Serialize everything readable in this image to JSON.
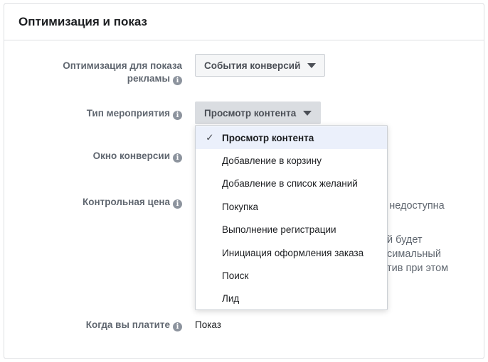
{
  "panel": {
    "title": "Оптимизация и показ"
  },
  "fields": {
    "optimization": {
      "label_line1": "Оптимизация для показа",
      "label_line2": "рекламы",
      "value": "События конверсий"
    },
    "event_type": {
      "label": "Тип мероприятия",
      "value": "Просмотр контента"
    },
    "conversion_window": {
      "label": "Окно конверсии"
    },
    "bid_cap": {
      "label": "Контрольная цена",
      "hidden_text": [
        "а\" недоступна",
        "й будет",
        "симальный",
        "тив при этом"
      ]
    },
    "when_you_pay": {
      "label": "Когда вы платите",
      "value": "Показ"
    }
  },
  "dropdown": {
    "items": [
      {
        "label": "Просмотр контента",
        "selected": true
      },
      {
        "label": "Добавление в корзину"
      },
      {
        "label": "Добавление в список желаний"
      },
      {
        "label": "Покупка"
      },
      {
        "label": "Выполнение регистрации"
      },
      {
        "label": "Инициация оформления заказа"
      },
      {
        "label": "Поиск"
      },
      {
        "label": "Лид"
      }
    ],
    "check_glyph": "✓"
  },
  "icons": {
    "info": "i"
  },
  "colors": {
    "selected_bg": "#ebf0fb",
    "label": "#606770",
    "border": "#dddfe2"
  }
}
